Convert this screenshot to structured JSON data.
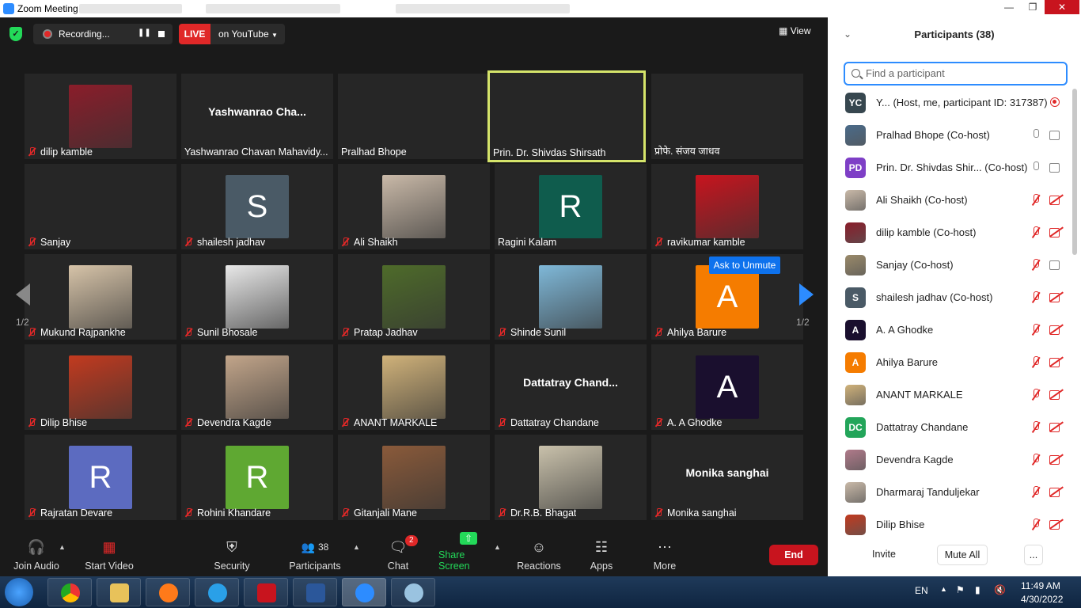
{
  "window": {
    "title": "Zoom Meeting"
  },
  "topbar": {
    "recording_label": "Recording...",
    "live_label": "LIVE",
    "stream_label": "on YouTube",
    "view_label": "View"
  },
  "gallery": {
    "page_indicator": "1/2",
    "unmute_tooltip": "Ask to Unmute",
    "tiles": [
      {
        "name": "dilip kamble",
        "muted": true,
        "avatar": "photo",
        "color": "#8a1d2a"
      },
      {
        "name": "Yashwanrao Chavan Mahavidy...",
        "big_name": "Yashwanrao  Cha...",
        "muted": false
      },
      {
        "name": "Pralhad Bhope",
        "muted": false
      },
      {
        "name": "Prin. Dr. Shivdas Shirsath",
        "muted": false,
        "active": true
      },
      {
        "name": "प्रोफे. संजय जाधव",
        "muted": false
      },
      {
        "name": "Sanjay",
        "muted": true
      },
      {
        "name": "shailesh jadhav",
        "muted": true,
        "initial": "S",
        "color": "#4a5a66"
      },
      {
        "name": "Ali Shaikh",
        "muted": true,
        "avatar": "photo",
        "color": "#c9b9a8"
      },
      {
        "name": "Ragini Kalam",
        "muted": false,
        "initial": "R",
        "color": "#0f5c4d"
      },
      {
        "name": "ravikumar kamble",
        "muted": true,
        "avatar": "photo",
        "color": "#c8141e"
      },
      {
        "name": "Mukund Rajpankhe",
        "muted": true,
        "avatar": "photo",
        "color": "#d6c3a8"
      },
      {
        "name": "Sunil Bhosale",
        "muted": true,
        "avatar": "photo",
        "color": "#e8e8e8"
      },
      {
        "name": "Pratap Jadhav",
        "muted": true,
        "avatar": "photo",
        "color": "#4e6b2a"
      },
      {
        "name": "Shinde Sunil",
        "muted": true,
        "avatar": "photo",
        "color": "#7fb8d8"
      },
      {
        "name": "Ahilya Barure",
        "muted": true,
        "initial": "A",
        "color": "#f57c00"
      },
      {
        "name": "Dilip Bhise",
        "muted": true,
        "avatar": "photo",
        "color": "#c23a1f"
      },
      {
        "name": "Devendra Kagde",
        "muted": true,
        "avatar": "photo",
        "color": "#c2a58a"
      },
      {
        "name": "ANANT MARKALE",
        "muted": true,
        "avatar": "photo",
        "color": "#d0b27a"
      },
      {
        "name": "Dattatray Chandane",
        "big_name": "Dattatray  Chand...",
        "muted": true
      },
      {
        "name": "A. A Ghodke",
        "muted": true,
        "initial": "A",
        "color": "#1a0f2e"
      },
      {
        "name": "Rajratan Devare",
        "muted": true,
        "initial": "R",
        "color": "#5c6bc0"
      },
      {
        "name": "Rohini Khandare",
        "muted": true,
        "initial": "R",
        "color": "#5fa832"
      },
      {
        "name": "Gitanjali Mane",
        "muted": true,
        "avatar": "photo",
        "color": "#8a5a3a"
      },
      {
        "name": "Dr.R.B. Bhagat",
        "muted": true,
        "avatar": "photo",
        "color": "#c9c1ab"
      },
      {
        "name": "Monika sanghai",
        "big_name": "Monika sanghai",
        "muted": true
      }
    ]
  },
  "toolbar": {
    "join_audio": "Join Audio",
    "start_video": "Start Video",
    "security": "Security",
    "participants": "Participants",
    "participants_count": "38",
    "chat": "Chat",
    "chat_badge": "2",
    "share_screen": "Share Screen",
    "reactions": "Reactions",
    "apps": "Apps",
    "more": "More",
    "end": "End"
  },
  "panel": {
    "title": "Participants (38)",
    "search_placeholder": "Find a participant",
    "invite": "Invite",
    "mute_all": "Mute All",
    "more": "...",
    "participants": [
      {
        "name": "Y... (Host, me, participant ID: 317387)",
        "initials": "YC",
        "color": "#37474f",
        "mic": "none",
        "cam": "rec"
      },
      {
        "name": "Pralhad Bhope (Co-host)",
        "initials": "",
        "color": "#4a6b8a",
        "mic": "on",
        "cam": "on"
      },
      {
        "name": "Prin. Dr. Shivdas Shir...  (Co-host)",
        "initials": "PD",
        "color": "#7e3fc6",
        "mic": "on",
        "cam": "on"
      },
      {
        "name": "Ali Shaikh (Co-host)",
        "initials": "",
        "color": "#c9b9a8",
        "mic": "muted",
        "cam": "muted"
      },
      {
        "name": "dilip kamble (Co-host)",
        "initials": "",
        "color": "#8a1d2a",
        "mic": "muted",
        "cam": "muted"
      },
      {
        "name": "Sanjay (Co-host)",
        "initials": "",
        "color": "#9a8a6a",
        "mic": "muted",
        "cam": "on"
      },
      {
        "name": "shailesh jadhav (Co-host)",
        "initials": "S",
        "color": "#4a5a66",
        "mic": "muted",
        "cam": "muted"
      },
      {
        "name": "A. A Ghodke",
        "initials": "A",
        "color": "#1a0f2e",
        "mic": "muted",
        "cam": "muted"
      },
      {
        "name": "Ahilya Barure",
        "initials": "A",
        "color": "#f57c00",
        "mic": "muted",
        "cam": "muted"
      },
      {
        "name": "ANANT MARKALE",
        "initials": "",
        "color": "#d0b27a",
        "mic": "muted",
        "cam": "muted"
      },
      {
        "name": "Dattatray Chandane",
        "initials": "DC",
        "color": "#23a55a",
        "mic": "muted",
        "cam": "muted"
      },
      {
        "name": "Devendra Kagde",
        "initials": "",
        "color": "#b07a8a",
        "mic": "muted",
        "cam": "muted"
      },
      {
        "name": "Dharmaraj Tanduljekar",
        "initials": "",
        "color": "#c9b9a8",
        "mic": "muted",
        "cam": "muted"
      },
      {
        "name": "Dilip Bhise",
        "initials": "",
        "color": "#c23a1f",
        "mic": "muted",
        "cam": "muted"
      }
    ]
  },
  "taskbar": {
    "language": "EN",
    "time": "11:49 AM",
    "date": "4/30/2022"
  }
}
